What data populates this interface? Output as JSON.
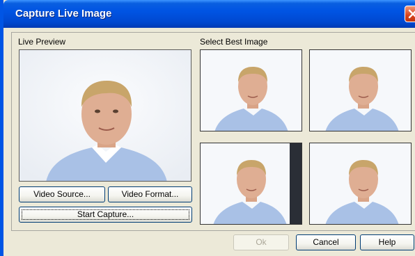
{
  "window": {
    "title": "Capture Live Image"
  },
  "left": {
    "preview_label": "Live Preview",
    "video_source": "Video Source...",
    "video_format": "Video Format...",
    "start_capture": "Start Capture..."
  },
  "right": {
    "select_label": "Select Best Image"
  },
  "footer": {
    "ok": "Ok",
    "cancel": "Cancel",
    "help": "Help"
  },
  "colors": {
    "title_bar": "#0054e3",
    "dialog_bg": "#ece9d8",
    "close_button": "#d8431c",
    "shirt": "#a9c1e6"
  },
  "icons": {
    "close": "close-icon"
  }
}
